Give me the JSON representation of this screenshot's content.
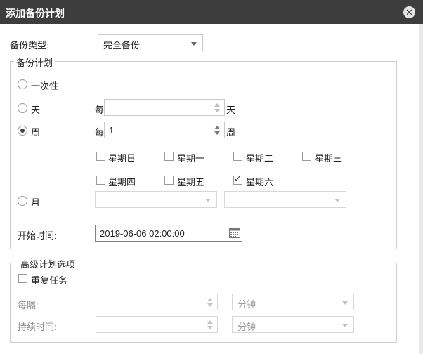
{
  "dialog": {
    "title": "添加备份计划",
    "close_glyph": "✕"
  },
  "backup_type": {
    "label": "备份类型:",
    "value": "完全备份"
  },
  "schedule": {
    "legend": "备份计划",
    "once_label": "一次性",
    "day_label": "天",
    "day_every": "每",
    "day_value": "",
    "day_unit": "天",
    "week_label": "周",
    "week_every": "每",
    "week_value": "1",
    "week_unit": "周",
    "selected_mode": "week",
    "weekdays": [
      {
        "label": "星期日",
        "checked": false
      },
      {
        "label": "星期一",
        "checked": false
      },
      {
        "label": "星期二",
        "checked": false
      },
      {
        "label": "星期三",
        "checked": false
      },
      {
        "label": "星期四",
        "checked": false
      },
      {
        "label": "星期五",
        "checked": false
      },
      {
        "label": "星期六",
        "checked": true
      }
    ],
    "month_label": "月",
    "month_select_1": "",
    "month_select_2": "",
    "start_time_label": "开始时间:",
    "start_time_value": "2019-06-06 02:00:00"
  },
  "advanced": {
    "legend": "高级计划选项",
    "repeat_label": "重复任务",
    "repeat_checked": false,
    "interval_label": "每隔:",
    "interval_value": "",
    "interval_unit": "分钟",
    "duration_label": "持续时间:",
    "duration_value": "",
    "duration_unit": "分钟"
  },
  "icons": {
    "close": "close-icon",
    "calendar": "calendar-icon",
    "dropdown": "chevron-down-icon",
    "spinner": "spinner-arrows-icon",
    "checkmark": "checkmark-icon"
  }
}
